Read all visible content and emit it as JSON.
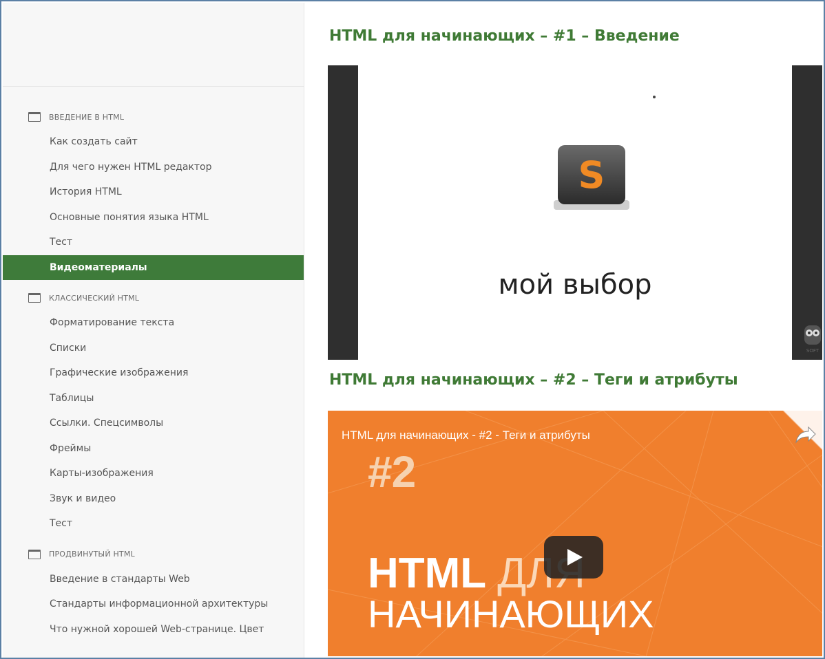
{
  "sidebar": {
    "sections": [
      {
        "title": "ВВЕДЕНИЕ В HTML",
        "items": [
          {
            "label": "Как создать сайт"
          },
          {
            "label": "Для чего нужен HTML редактор"
          },
          {
            "label": "История HTML"
          },
          {
            "label": "Основные понятия языка HTML"
          },
          {
            "label": "Тест"
          },
          {
            "label": "Видеоматериалы",
            "active": true
          }
        ]
      },
      {
        "title": "КЛАССИЧЕСКИЙ HTML",
        "items": [
          {
            "label": "Форматирование текста"
          },
          {
            "label": "Списки"
          },
          {
            "label": "Графические изображения"
          },
          {
            "label": "Таблицы"
          },
          {
            "label": "Ссылки. Спецсимволы"
          },
          {
            "label": "Фреймы"
          },
          {
            "label": "Карты-изображения"
          },
          {
            "label": "Звук и видео"
          },
          {
            "label": "Тест"
          }
        ]
      },
      {
        "title": "ПРОДВИНУТЫЙ HTML",
        "items": [
          {
            "label": "Введение в стандарты Web"
          },
          {
            "label": "Стандарты информационной архитектуры"
          },
          {
            "label": "Что нужной хорошей Web-странице. Цвет"
          }
        ]
      }
    ]
  },
  "videos": [
    {
      "title": "HTML для начинающих – #1 – Введение",
      "caption": "мой выбор",
      "app_letter": "S",
      "watermark": "SOFT"
    },
    {
      "title": "HTML для начинающих – #2 – Теги и атрибуты",
      "player_title": "HTML для начинающих - #2 - Теги и атрибуты",
      "number": "#2",
      "big_line_1_bold": "HTML",
      "big_line_1_light": "ДЛЯ",
      "big_line_2": "НАЧИНАЮЩИХ"
    }
  ],
  "colors": {
    "accent_green": "#3e7b3a",
    "title_green": "#3f7a35",
    "video_orange": "#f07f2d"
  },
  "icons": {
    "section": "folder-icon",
    "play": "play-icon",
    "share": "share-icon"
  }
}
